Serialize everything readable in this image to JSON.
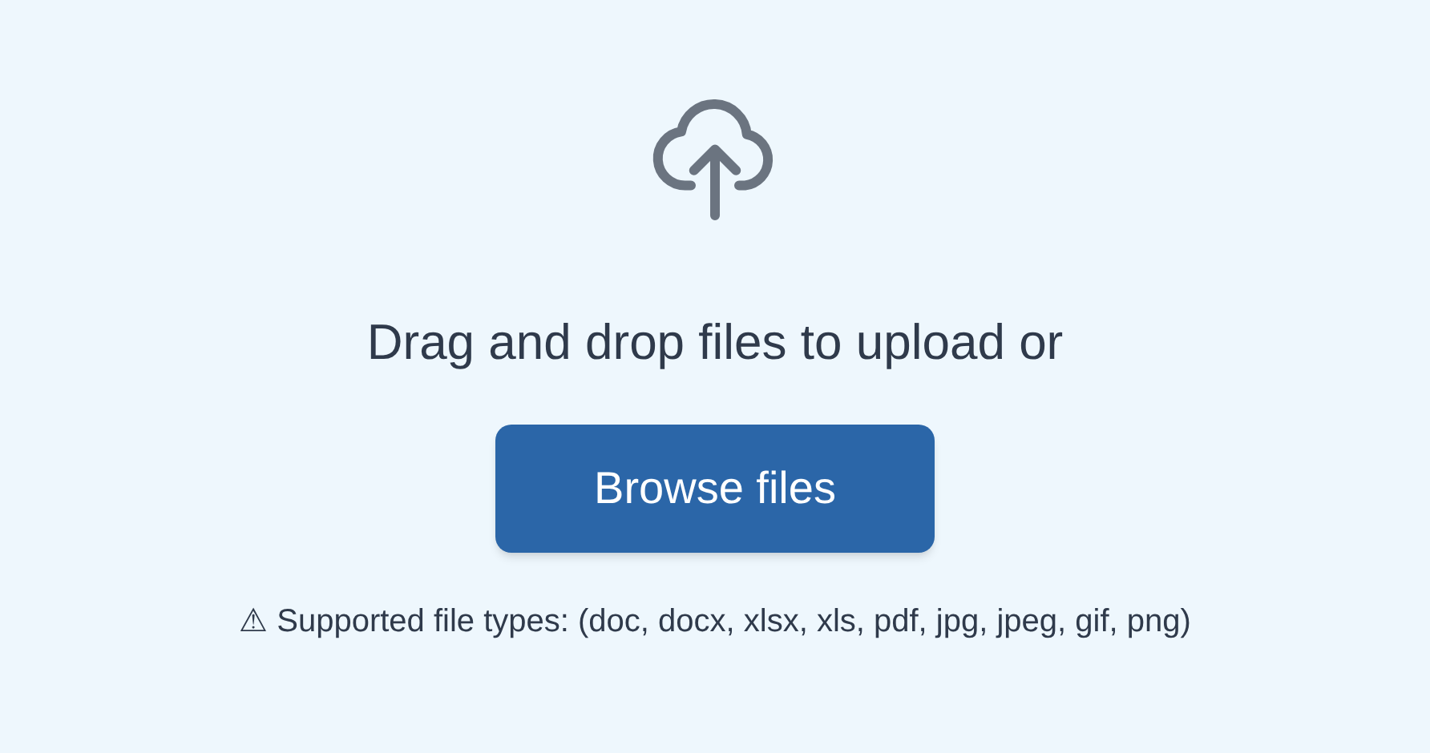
{
  "dropzone": {
    "prompt": "Drag and drop files to upload or",
    "button": "Browse files",
    "notice": "⚠ Supported file types: (doc, docx, xlsx, xls, pdf, jpg, jpeg, gif, png)"
  }
}
